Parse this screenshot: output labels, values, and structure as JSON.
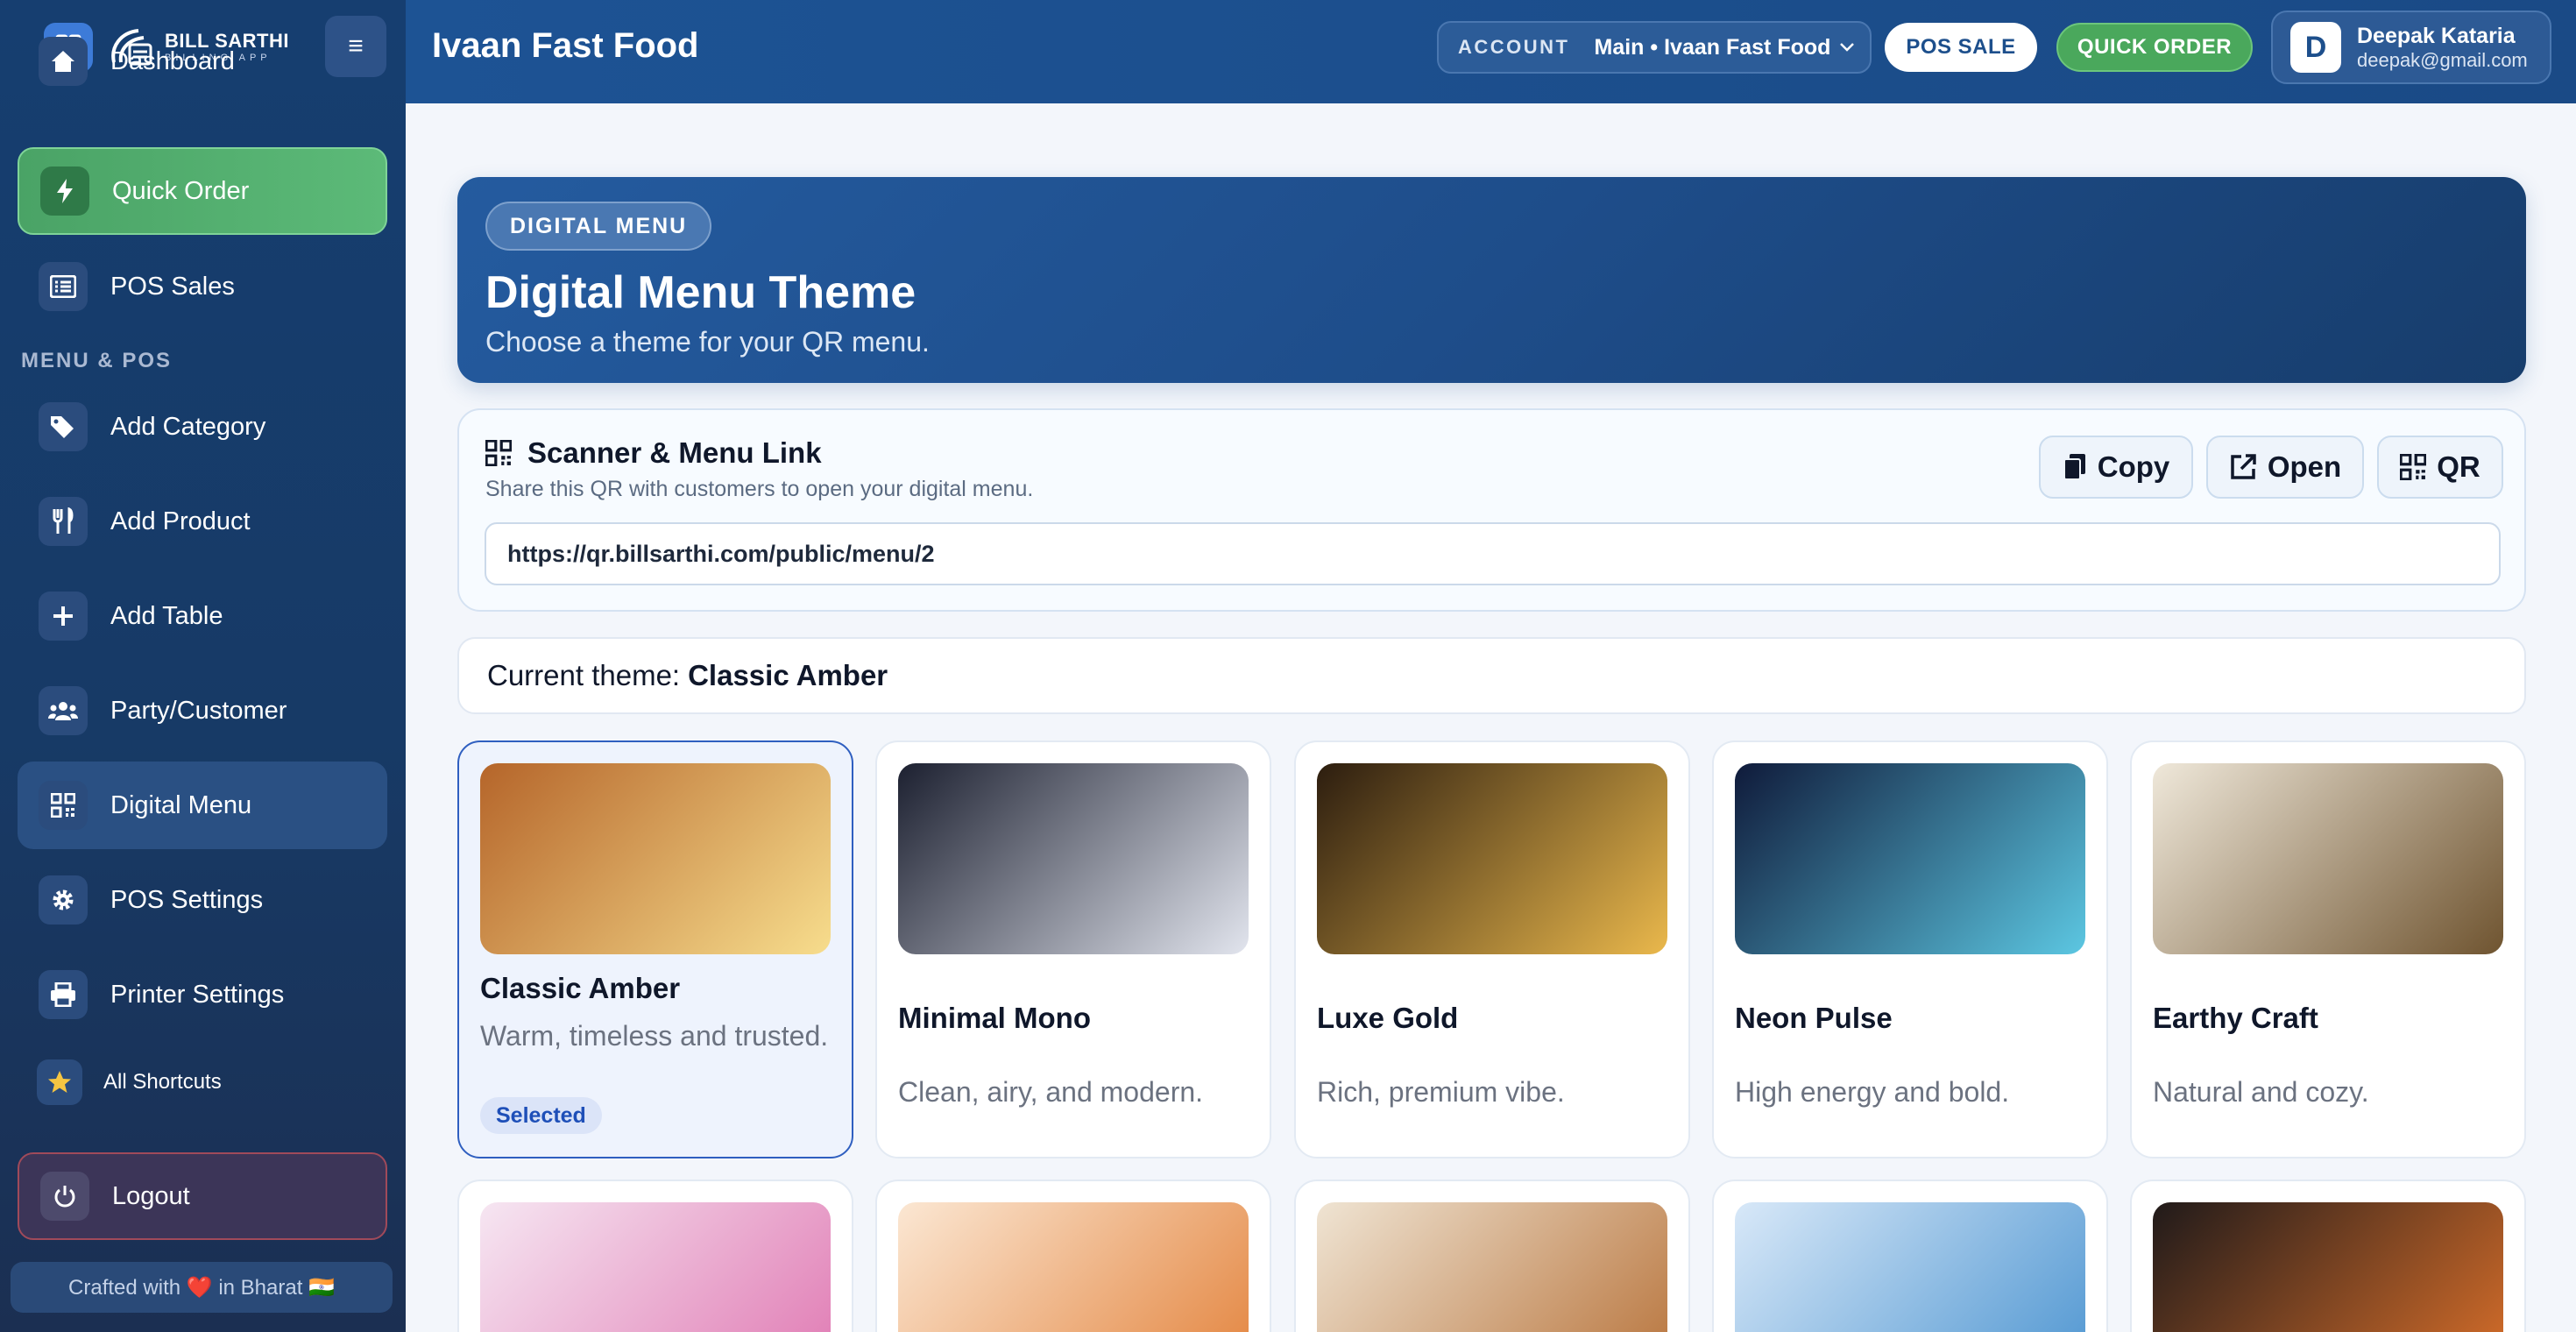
{
  "brand": {
    "name": "BILL SARTHI",
    "sub": "BILLING APP"
  },
  "sidebar": {
    "items": [
      {
        "label": "Dashboard",
        "icon": "home-icon"
      },
      {
        "label": "Quick Order",
        "icon": "bolt-icon"
      },
      {
        "label": "POS Sales",
        "icon": "list-icon"
      }
    ],
    "section": "MENU & POS",
    "menu_items": [
      {
        "label": "Add Category",
        "icon": "tags-icon"
      },
      {
        "label": "Add Product",
        "icon": "utensils-icon"
      },
      {
        "label": "Add Table",
        "icon": "plus-icon"
      },
      {
        "label": "Party/Customer",
        "icon": "users-icon"
      },
      {
        "label": "Digital Menu",
        "icon": "qrcode-icon"
      },
      {
        "label": "POS Settings",
        "icon": "gear-icon"
      },
      {
        "label": "Printer Settings",
        "icon": "printer-icon"
      },
      {
        "label": "All Shortcuts",
        "icon": "star-icon"
      }
    ],
    "logout": "Logout",
    "footer": "Crafted with ❤️ in Bharat 🇮🇳"
  },
  "header": {
    "title": "Ivaan Fast Food",
    "account_label": "ACCOUNT",
    "account_value": "Main • Ivaan Fast Food",
    "pos_sale": "POS SALE",
    "quick_order": "QUICK ORDER",
    "user": {
      "initial": "D",
      "name": "Deepak Kataria",
      "email": "deepak@gmail.com"
    }
  },
  "hero": {
    "badge": "DIGITAL MENU",
    "title": "Digital Menu Theme",
    "subtitle": "Choose a theme for your QR menu."
  },
  "scanner": {
    "title": "Scanner & Menu Link",
    "subtitle": "Share this QR with customers to open your digital menu.",
    "copy": "Copy",
    "open": "Open",
    "qr": "QR",
    "url": "https://qr.billsarthi.com/public/menu/2"
  },
  "current_theme": {
    "label": "Current theme:",
    "value": "Classic Amber"
  },
  "themes": [
    {
      "name": "Classic Amber",
      "desc": "Warm, timeless and trusted.",
      "selected": true,
      "badge": "Selected",
      "from": "#b5652a",
      "to": "#f7dd8d"
    },
    {
      "name": "Minimal Mono",
      "desc": "Clean, airy, and modern.",
      "from": "#1c2030",
      "to": "#e2e5ee"
    },
    {
      "name": "Luxe Gold",
      "desc": "Rich, premium vibe.",
      "from": "#2c1d0f",
      "to": "#eab84c"
    },
    {
      "name": "Neon Pulse",
      "desc": "High energy and bold.",
      "from": "#0f1a3a",
      "to": "#5cc7e2"
    },
    {
      "name": "Earthy Craft",
      "desc": "Natural and cozy.",
      "from": "#efe8da",
      "to": "#6f5430"
    }
  ],
  "themes_row2": [
    {
      "from": "#f6e6f2",
      "to": "#e07ab3"
    },
    {
      "from": "#fbe7d3",
      "to": "#e3843e"
    },
    {
      "from": "#efe4d3",
      "to": "#b8743c"
    },
    {
      "from": "#d8e8f8",
      "to": "#4f96d1"
    },
    {
      "from": "#201a1a",
      "to": "#d96f2a"
    }
  ]
}
